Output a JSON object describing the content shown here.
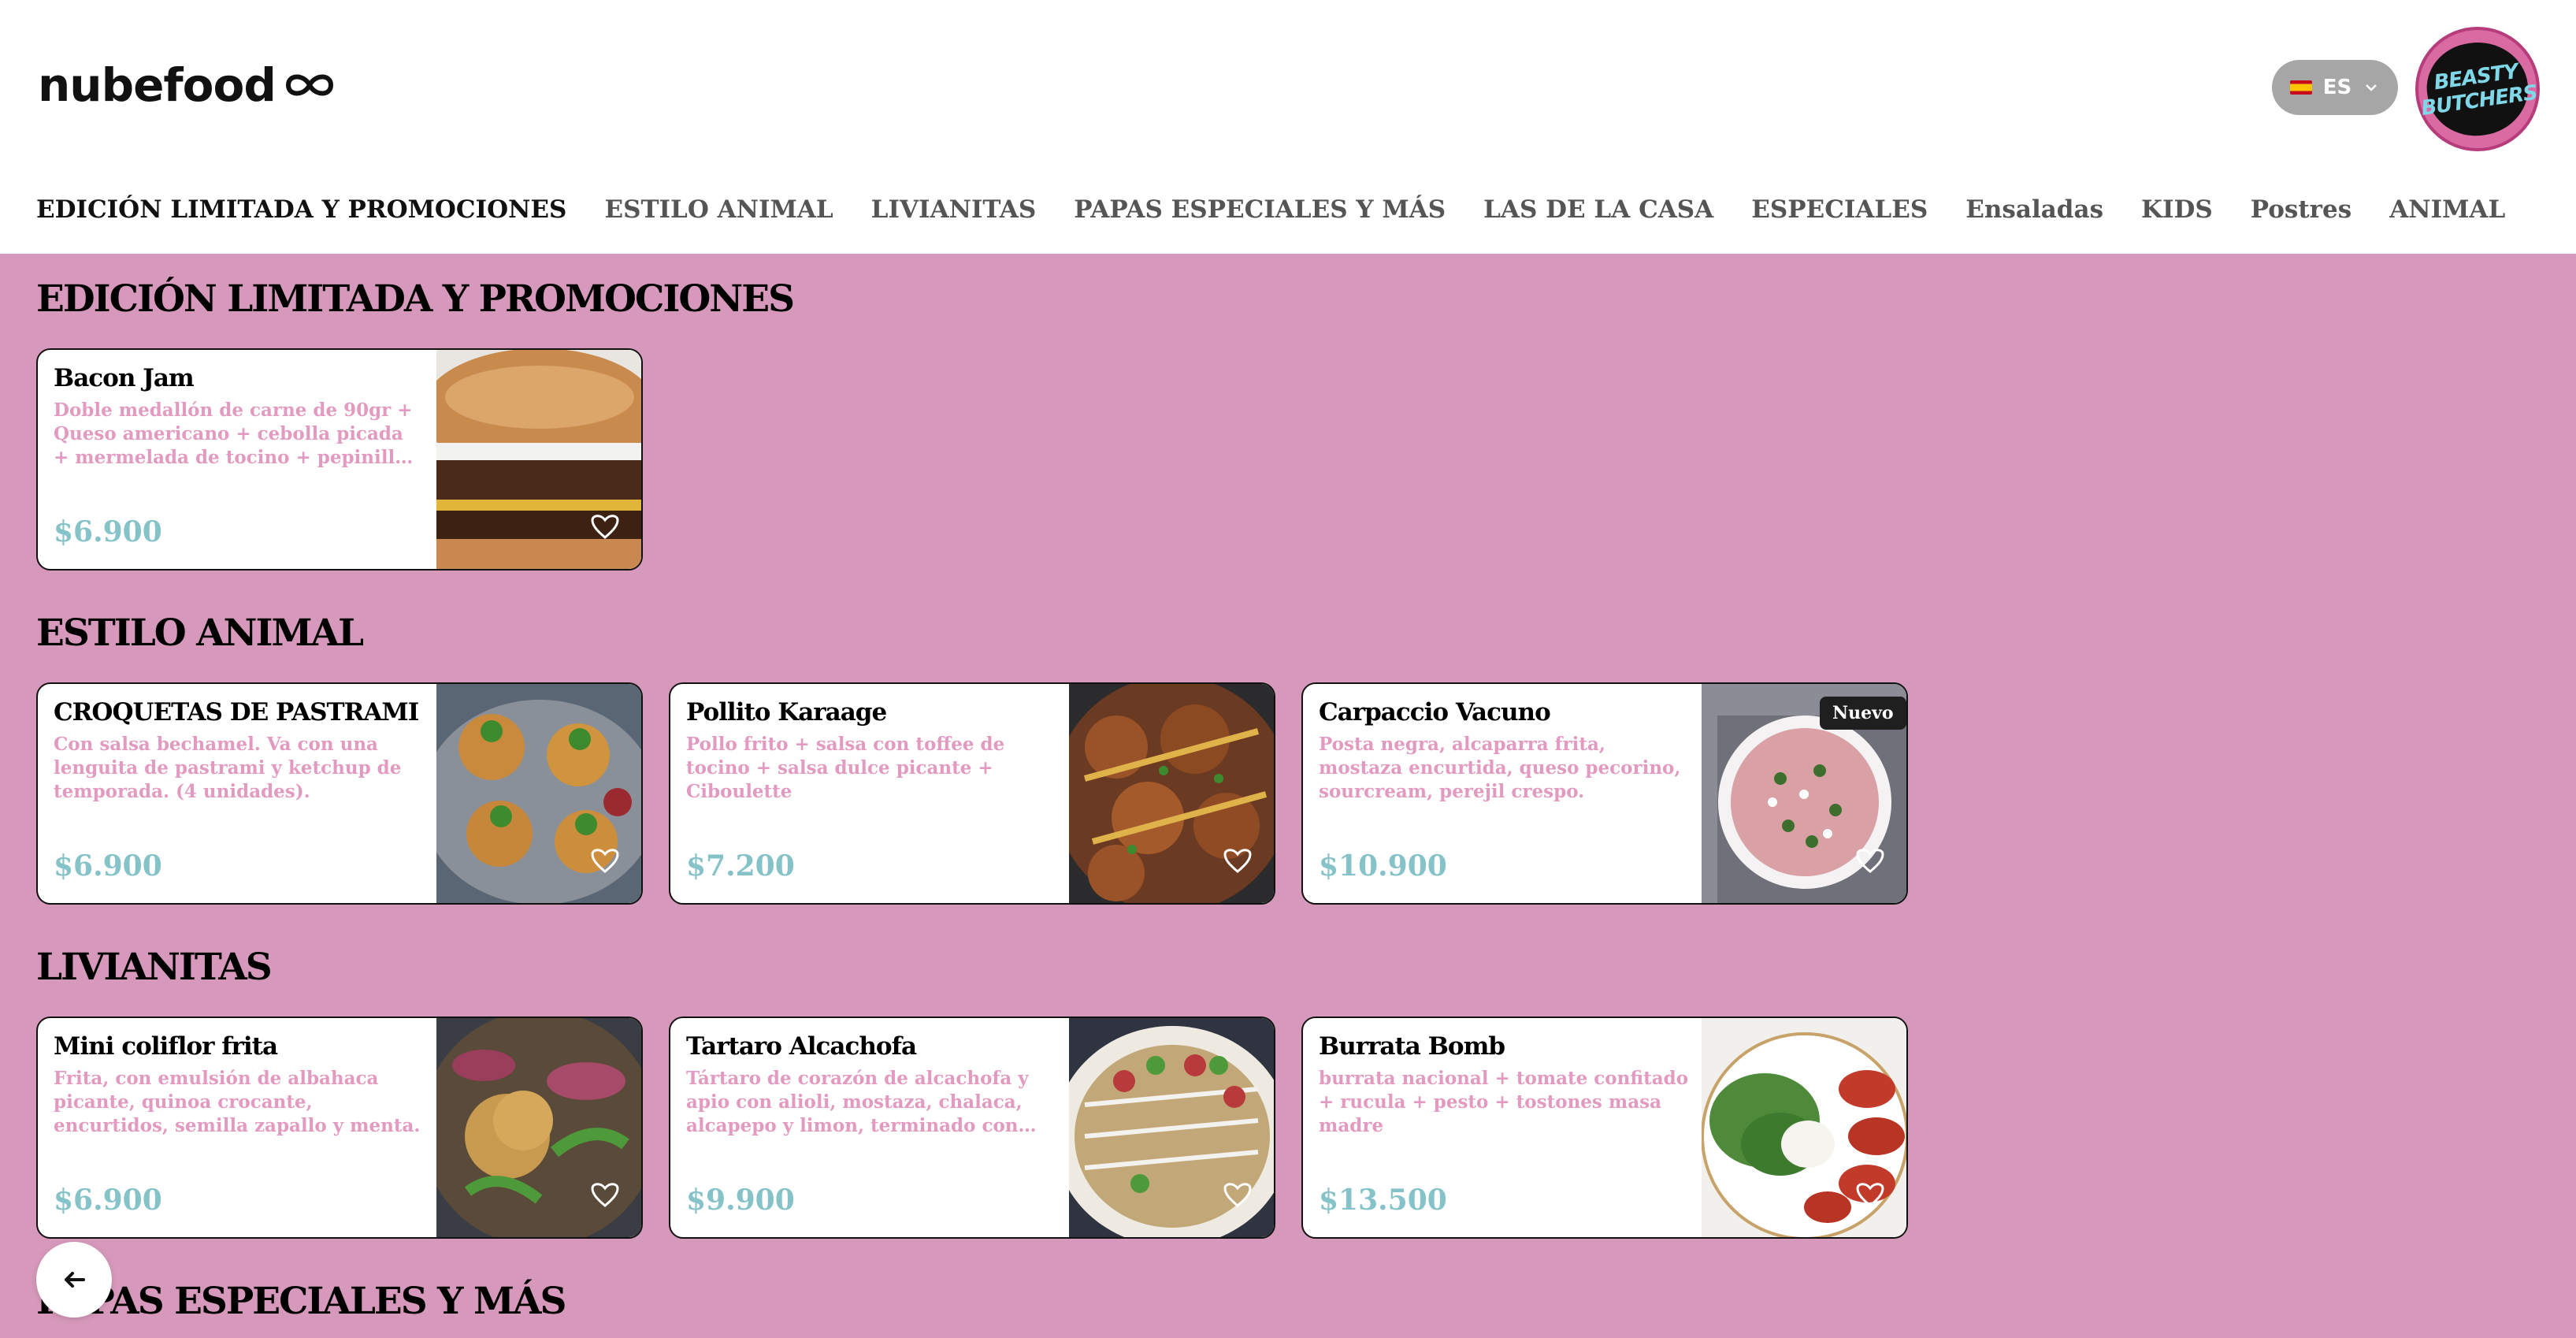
{
  "header": {
    "logo_text": "nubefood",
    "language": "ES",
    "brand_logo_lines": [
      "BEASTY",
      "BUTCHERS"
    ]
  },
  "nav": [
    "EDICIÓN LIMITADA Y PROMOCIONES",
    "ESTILO ANIMAL",
    "LIVIANITAS",
    "PAPAS ESPECIALES Y MÁS",
    "LAS DE LA CASA",
    "ESPECIALES",
    "Ensaladas",
    "KIDS",
    "Postres",
    "ANIMAL"
  ],
  "sections": [
    {
      "title": "EDICIÓN LIMITADA Y PROMOCIONES",
      "items": [
        {
          "name": "Bacon Jam",
          "description": "Doble medallón de carne de 90gr + Queso americano + cebolla picada + mermelada de tocino + pepinillos + salsa de la casa",
          "price": "$6.900",
          "image": "burger"
        }
      ]
    },
    {
      "title": "ESTILO ANIMAL",
      "items": [
        {
          "name": "CROQUETAS DE PASTRAMI",
          "description": "Con salsa bechamel. Va con una lenguita de pastrami y ketchup de temporada. (4 unidades).",
          "price": "$6.900",
          "image": "croquettes"
        },
        {
          "name": "Pollito Karaage",
          "description": "Pollo frito + salsa con toffee de tocino + salsa dulce picante + Ciboulette",
          "price": "$7.200",
          "image": "karaage"
        },
        {
          "name": "Carpaccio Vacuno",
          "description": "Posta negra, alcaparra frita, mostaza encurtida, queso pecorino, sourcream, perejil crespo.",
          "price": "$10.900",
          "image": "carpaccio",
          "badge": "Nuevo"
        }
      ]
    },
    {
      "title": "LIVIANITAS",
      "items": [
        {
          "name": "Mini coliflor frita",
          "description": "Frita, con emulsión de albahaca picante, quinoa crocante, encurtidos, semilla zapallo y menta.",
          "price": "$6.900",
          "image": "cauliflower"
        },
        {
          "name": "Tartaro Alcachofa",
          "description": "Tártaro de corazón de alcachofa y apio con alioli, mostaza, chalaca, alcapepo y limon, terminado con Bruselas fritas y crocante de quinoa",
          "price": "$9.900",
          "image": "artichoke"
        },
        {
          "name": "Burrata Bomb",
          "description": "burrata nacional + tomate confitado + rucula + pesto + tostones masa madre",
          "price": "$13.500",
          "image": "burrata"
        }
      ]
    },
    {
      "title": "PAPAS ESPECIALES Y MÁS",
      "items": []
    }
  ],
  "icons": {
    "logo_mark": "infinity-icon",
    "chevron": "chevron-down-icon",
    "heart": "heart-icon",
    "back": "arrow-left-icon"
  },
  "colors": {
    "background": "#d799bb",
    "description": "#e39ac0",
    "price": "#86c3c8"
  }
}
